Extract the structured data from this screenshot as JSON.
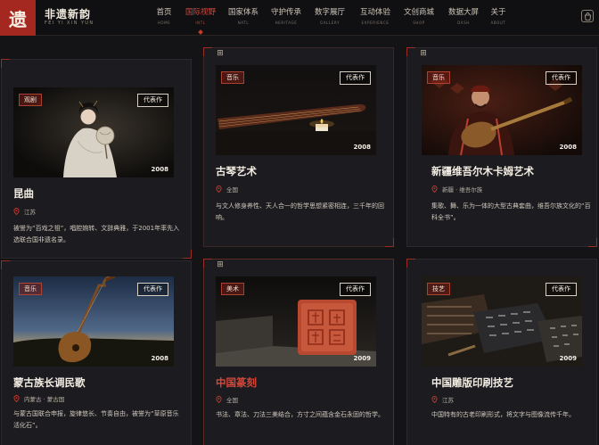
{
  "brand": {
    "badge": "遗",
    "name": "非遗新韵",
    "sub": "FEI YI XIN YUN"
  },
  "nav": [
    {
      "zh": "首页",
      "en": "HOME"
    },
    {
      "zh": "国际视野",
      "en": "INTL"
    },
    {
      "zh": "国家体系",
      "en": "NATL"
    },
    {
      "zh": "守护传承",
      "en": "HERITAGE"
    },
    {
      "zh": "数字展厅",
      "en": "GALLERY"
    },
    {
      "zh": "互动体验",
      "en": "EXPERIENCE"
    },
    {
      "zh": "文创商城",
      "en": "SHOP"
    },
    {
      "zh": "数据大屏",
      "en": "DASH"
    },
    {
      "zh": "关于",
      "en": "ABOUT"
    }
  ],
  "active_nav": "国际视野",
  "icons": {
    "cart": "shopping-bag-icon",
    "pin": "location-pin-icon"
  },
  "colors": {
    "accent": "#c9392d",
    "background": "#141416",
    "card": "#1c1c20"
  },
  "rep_label": "代表作",
  "cards": [
    {
      "category": "观剧",
      "year": "2008",
      "title": "昆曲",
      "location": "江苏",
      "desc": "被誉为“百戏之祖”，唱腔婉转、文辞典雅，于2001年率先入选联合国非遗名录。"
    },
    {
      "category": "音乐",
      "year": "2008",
      "title": "古琴艺术",
      "location": "全国",
      "desc": "与文人修身养性、天人合一的哲学思想紧密相连，三千年的回响。"
    },
    {
      "category": "音乐",
      "year": "2008",
      "title": "新疆维吾尔木卡姆艺术",
      "location": "新疆 · 维吾尔族",
      "desc": "集歌、舞、乐为一体的大型古典套曲，维吾尔族文化的“百科全书”。"
    },
    {
      "category": "音乐",
      "year": "2008",
      "title": "蒙古族长调民歌",
      "location": "内蒙古 · 蒙古国",
      "desc": "与蒙古国联合申报，旋律悠长、节奏自由，被誉为“草原音乐活化石”。"
    },
    {
      "category": "美术",
      "year": "2009",
      "title": "中国篆刻",
      "location": "全国",
      "desc": "书法、章法、刀法三美结合，方寸之间蕴含金石永固的哲学。"
    },
    {
      "category": "技艺",
      "year": "2009",
      "title": "中国雕版印刷技艺",
      "location": "江苏",
      "desc": "中国特有的古老印刷形式，将文字与图像流传千年。"
    }
  ]
}
